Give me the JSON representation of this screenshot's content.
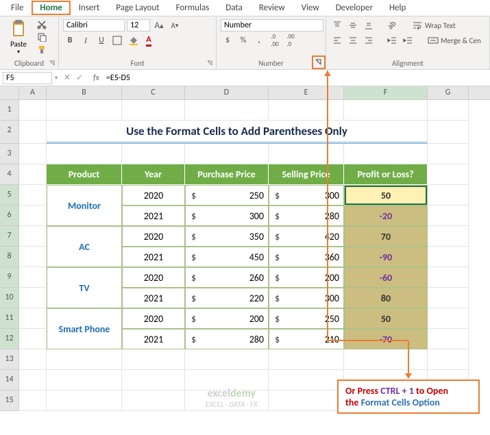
{
  "tabs": [
    "File",
    "Home",
    "Insert",
    "Page Layout",
    "Formulas",
    "Data",
    "Review",
    "View",
    "Developer",
    "Help"
  ],
  "ribbon": {
    "clipboard": {
      "label": "Clipboard",
      "paste": "Paste"
    },
    "font": {
      "label": "Font",
      "name": "Calibri",
      "size": "12",
      "bold": "B",
      "italic": "I",
      "underline": "U"
    },
    "number": {
      "label": "Number",
      "format": "Number",
      "currency": "$",
      "percent": "%"
    },
    "alignment": {
      "label": "Alignment",
      "wrap": "Wrap Text",
      "merge": "Merge & Cen"
    }
  },
  "namebox": "F5",
  "formula": "=E5-D5",
  "cols": [
    "A",
    "B",
    "C",
    "D",
    "E",
    "F",
    "G"
  ],
  "title": "Use the Format Cells to Add Parentheses Only",
  "headers": {
    "product": "Product",
    "year": "Year",
    "purchase": "Purchase Price",
    "selling": "Selling Price",
    "profit": "Profit or Loss?"
  },
  "products": [
    "Monitor",
    "AC",
    "TV",
    "Smart Phone"
  ],
  "rows": [
    {
      "year": "2020",
      "pp": "250",
      "sp": "300",
      "pl": "50",
      "neg": false
    },
    {
      "year": "2021",
      "pp": "300",
      "sp": "280",
      "pl": "-20",
      "neg": true
    },
    {
      "year": "2020",
      "pp": "350",
      "sp": "420",
      "pl": "70",
      "neg": false
    },
    {
      "year": "2021",
      "pp": "450",
      "sp": "360",
      "pl": "-90",
      "neg": true
    },
    {
      "year": "2020",
      "pp": "260",
      "sp": "200",
      "pl": "-60",
      "neg": true
    },
    {
      "year": "2021",
      "pp": "220",
      "sp": "300",
      "pl": "80",
      "neg": false
    },
    {
      "year": "2020",
      "pp": "200",
      "sp": "250",
      "pl": "50",
      "neg": false
    },
    {
      "year": "2021",
      "pp": "280",
      "sp": "210",
      "pl": "-70",
      "neg": true
    }
  ],
  "annot": {
    "t1": "Or Press ",
    "t2": "CTRL + 1",
    "t3": " to Open",
    "t4": "the ",
    "t5": "Format Cells Option"
  },
  "watermark": {
    "brand_a": "excel",
    "brand_b": "demy",
    "tag": "EXCEL · DATA · FX"
  }
}
